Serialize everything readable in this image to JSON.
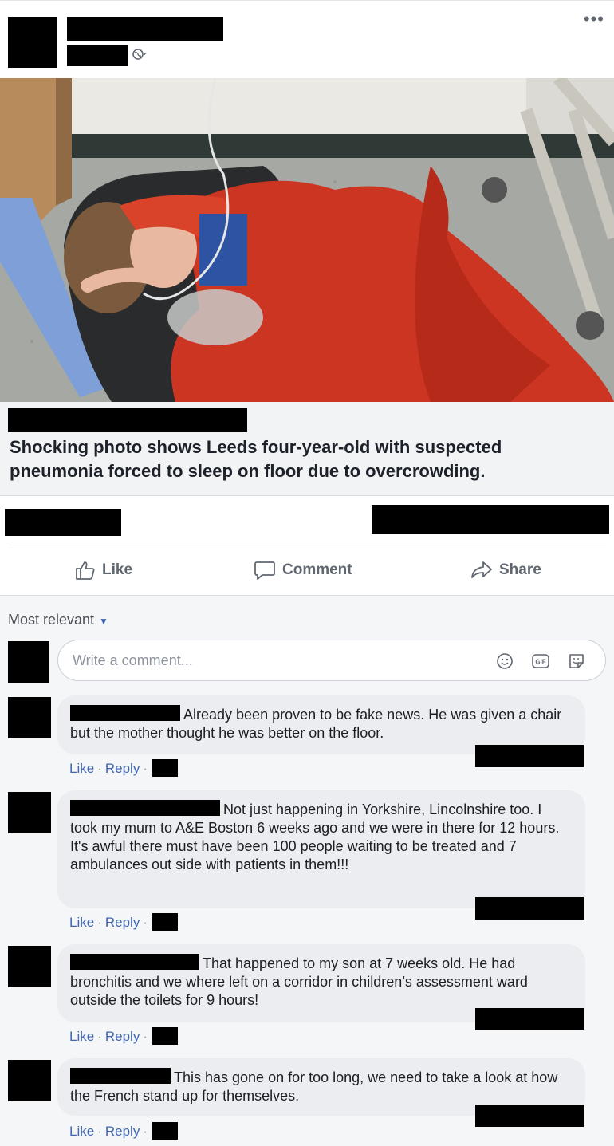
{
  "post": {
    "more_glyph": "•••",
    "link_headline": "Shocking photo shows Leeds four-year-old with suspected pneumonia forced to sleep on floor due to overcrowding."
  },
  "actions": {
    "like": "Like",
    "comment": "Comment",
    "share": "Share"
  },
  "comments_section": {
    "sort_label": "Most relevant",
    "input_placeholder": "Write a comment...",
    "input_icons": [
      "emoji-icon",
      "gif-icon",
      "sticker-icon"
    ]
  },
  "comments": [
    {
      "text": "Already been proven to be fake news. He was given a chair but the mother thought he was better on the floor.",
      "like": "Like",
      "reply": "Reply"
    },
    {
      "text": "Not just happening in Yorkshire, Lincolnshire too. I took my mum to A&E Boston 6 weeks ago and we were in there for 12 hours. It's awful there must have been 100 people waiting to be treated and 7 ambulances out side with patients in them!!!",
      "like": "Like",
      "reply": "Reply"
    },
    {
      "text": "That happened to my son at 7 weeks old. He had bronchitis and we where left on a corridor in children’s assessment ward outside the toilets for 9 hours!",
      "like": "Like",
      "reply": "Reply"
    },
    {
      "text": "This has gone on for too long, we need to take a look at how the French stand up for themselves.",
      "like": "Like",
      "reply": "Reply"
    }
  ],
  "colors": {
    "link_blue": "#4267b2",
    "muted_gray": "#606770",
    "bubble_gray": "#ebedf0",
    "preview_gray": "#f2f3f5"
  }
}
